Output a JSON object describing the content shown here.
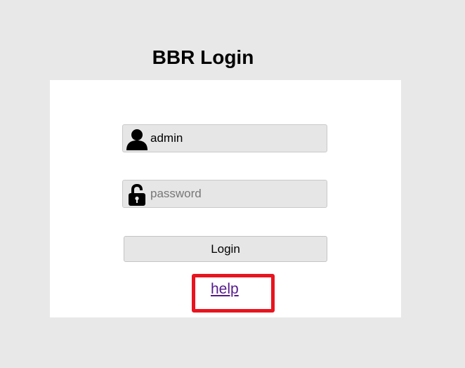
{
  "page": {
    "title": "BBR Login"
  },
  "form": {
    "username": {
      "value": "admin",
      "icon": "user-icon"
    },
    "password": {
      "value": "",
      "placeholder": "password",
      "icon": "lock-icon"
    },
    "login_label": "Login",
    "help_label": "help"
  },
  "colors": {
    "background": "#e8e8e8",
    "panel": "#ffffff",
    "field": "#e6e6e6",
    "highlight_border": "#e8141f",
    "link": "#551a8b"
  }
}
